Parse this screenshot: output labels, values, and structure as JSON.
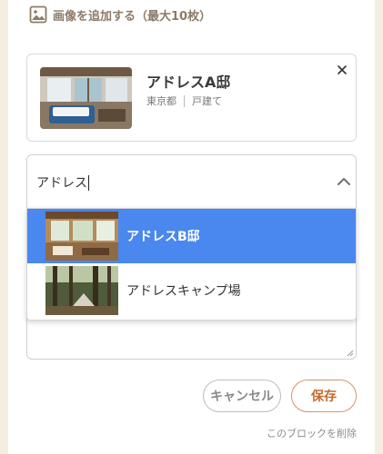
{
  "add_image": {
    "label": "画像を追加する（最大10枚）",
    "icon": "image-icon"
  },
  "selected_property": {
    "name": "アドレスA邸",
    "prefecture": "東京都",
    "type": "戸建て",
    "close_icon": "close-icon"
  },
  "search": {
    "value": "アドレス",
    "chevron_icon": "chevron-up-icon"
  },
  "options": [
    {
      "label": "アドレスB邸",
      "selected": true
    },
    {
      "label": "アドレスキャンプ場",
      "selected": false
    }
  ],
  "buttons": {
    "cancel": "キャンセル",
    "save": "保存"
  },
  "delete_link": "このブロックを削除",
  "colors": {
    "accent": "#c46a2e",
    "selected_option": "#4a87ee",
    "background": "#f6ede1",
    "muted_text": "#8c7b68"
  }
}
